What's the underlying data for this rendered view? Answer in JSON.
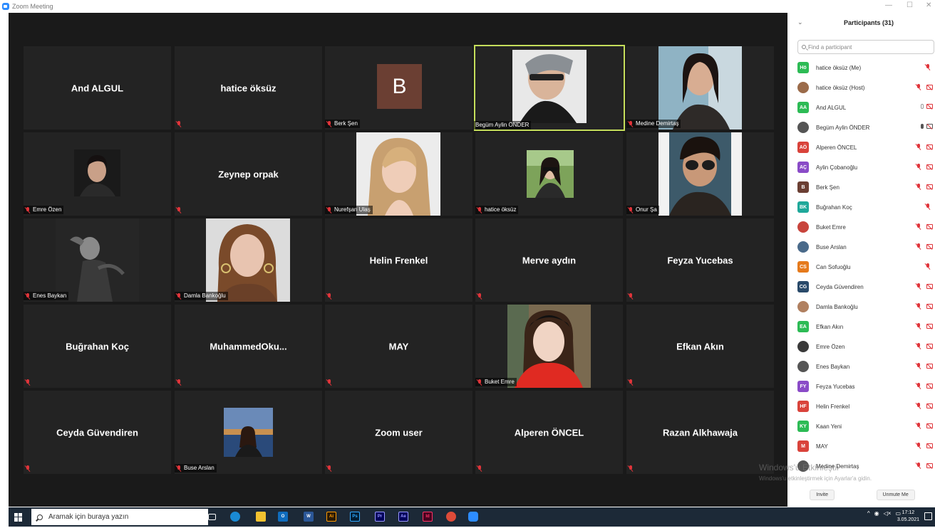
{
  "window": {
    "title": "Zoom Meeting",
    "minimize": "—",
    "maximize": "☐",
    "close": "✕"
  },
  "tiles": [
    {
      "name": "And ALGUL",
      "label": ""
    },
    {
      "name": "hatice öksüz",
      "label": ""
    },
    {
      "name": "",
      "label": "Berk Şen",
      "avatar_letter": "B"
    },
    {
      "name": "",
      "label": "Begüm Aylin ÖNDER"
    },
    {
      "name": "",
      "label": "Medine Demirtaş"
    },
    {
      "name": "",
      "label": "Emre Özen"
    },
    {
      "name": "Zeynep orpak",
      "label": ""
    },
    {
      "name": "",
      "label": "Nurefşan Ulaş"
    },
    {
      "name": "",
      "label": "hatice öksüz"
    },
    {
      "name": "",
      "label": "Onur Şa"
    },
    {
      "name": "",
      "label": "Enes Baykan"
    },
    {
      "name": "",
      "label": "Damla Bankoğlu"
    },
    {
      "name": "Helin Frenkel",
      "label": ""
    },
    {
      "name": "Merve aydın",
      "label": ""
    },
    {
      "name": "Feyza Yucebas",
      "label": ""
    },
    {
      "name": "Buğrahan Koç",
      "label": ""
    },
    {
      "name": "MuhammedOku...",
      "label": ""
    },
    {
      "name": "MAY",
      "label": ""
    },
    {
      "name": "",
      "label": "Buket Emre"
    },
    {
      "name": "Efkan Akın",
      "label": ""
    },
    {
      "name": "Ceyda Güvendiren",
      "label": ""
    },
    {
      "name": "",
      "label": "Buse Arslan"
    },
    {
      "name": "Zoom user",
      "label": ""
    },
    {
      "name": "Alperen ÖNCEL",
      "label": ""
    },
    {
      "name": "Razan Alkhawaja",
      "label": ""
    }
  ],
  "panel": {
    "title": "Participants (31)",
    "search_placeholder": "Find a participant",
    "participants": [
      {
        "initials": "Hö",
        "name": "hatice öksüz (Me)",
        "color": "#2dbb55"
      },
      {
        "initials": "",
        "name": "hatice öksüz (Host)",
        "color": "#9b6b4a"
      },
      {
        "initials": "AA",
        "name": "And ALGUL",
        "color": "#2dbb55"
      },
      {
        "initials": "",
        "name": "Begüm Aylin ÖNDER",
        "color": "#555555"
      },
      {
        "initials": "AÖ",
        "name": "Alperen ÖNCEL",
        "color": "#d9433b"
      },
      {
        "initials": "AÇ",
        "name": "Aylin Çobanoğlu",
        "color": "#8a4bc7"
      },
      {
        "initials": "B",
        "name": "Berk Şen",
        "color": "#6b3f33"
      },
      {
        "initials": "BK",
        "name": "Buğrahan Koç",
        "color": "#1fa89a"
      },
      {
        "initials": "",
        "name": "Buket Emre",
        "color": "#c8443c"
      },
      {
        "initials": "",
        "name": "Buse Arslan",
        "color": "#4a6a8a"
      },
      {
        "initials": "CS",
        "name": "Can Sofuoğlu",
        "color": "#e57a1c"
      },
      {
        "initials": "CG",
        "name": "Ceyda Güvendiren",
        "color": "#2a4a6a"
      },
      {
        "initials": "",
        "name": "Damla Bankoğlu",
        "color": "#b08060"
      },
      {
        "initials": "EA",
        "name": "Efkan Akın",
        "color": "#2dbb55"
      },
      {
        "initials": "",
        "name": "Emre Özen",
        "color": "#3a3a3a"
      },
      {
        "initials": "",
        "name": "Enes Baykan",
        "color": "#555555"
      },
      {
        "initials": "FY",
        "name": "Feyza Yucebas",
        "color": "#8a4bc7"
      },
      {
        "initials": "HF",
        "name": "Helin Frenkel",
        "color": "#d9433b"
      },
      {
        "initials": "KY",
        "name": "Kaan Yeni",
        "color": "#2dbb55"
      },
      {
        "initials": "M",
        "name": "MAY",
        "color": "#d9433b"
      },
      {
        "initials": "",
        "name": "Medine Demirtaş",
        "color": "#555555"
      }
    ],
    "invite": "Invite",
    "unmute_me": "Unmute Me"
  },
  "watermark": {
    "line1": "Windows'u Etkinleştir",
    "line2": "Windows'u etkinleştirmek için Ayarlar'a gidin."
  },
  "taskbar": {
    "search_text": "Aramak için buraya yazın",
    "time": "17:12",
    "date": "3.05.2021",
    "apps": [
      "task-view",
      "edge",
      "explorer",
      "outlook",
      "word",
      "illustrator",
      "photoshop",
      "premiere",
      "after-effects",
      "indesign",
      "chrome",
      "zoom"
    ]
  }
}
